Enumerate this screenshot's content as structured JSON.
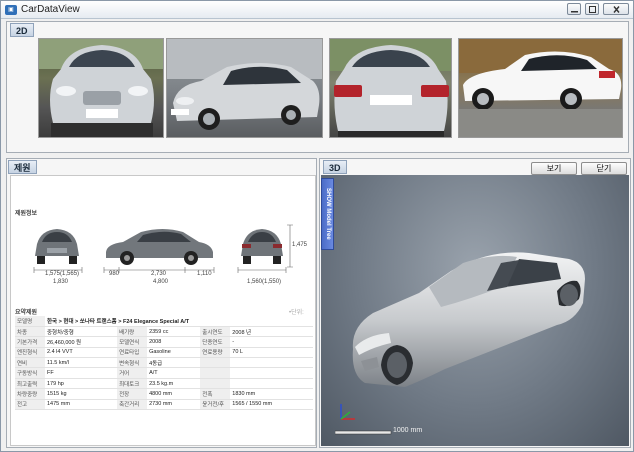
{
  "window": {
    "title": "CarDataView",
    "icon": "app-icon"
  },
  "tabs": {
    "photos": "2D",
    "specs": "제원",
    "viewer": "3D"
  },
  "viewer": {
    "side_tab": "SHOW Model Tree",
    "view_button": "보기",
    "close_button": "닫기",
    "scale_label": "1000 mm",
    "axis_labels": {
      "z": "Z",
      "x": "X",
      "y": "Y"
    }
  },
  "specs": {
    "section_title": "제원정보",
    "dims": {
      "front_track": "1,575(1,565)",
      "front_width": "1,830",
      "side_a": "980",
      "wheelbase": "2,730",
      "side_b": "1,110",
      "length": "4,800",
      "height": "1,475",
      "rear_track": "1,560(1,550)"
    },
    "summary_title": "요약제원",
    "summary_note": "•단위:",
    "rows": [
      [
        {
          "k": "모델명",
          "v": "한국 > 현대 > 쏘나타 트랜스폼 > F24 Elegance Special A/T",
          "span": true
        }
      ],
      [
        {
          "k": "차종",
          "v": "중형차/중형"
        },
        {
          "k": "배기량",
          "v": "2359 cc"
        },
        {
          "k": "출시연도",
          "v": "2008 년"
        }
      ],
      [
        {
          "k": "기본가격",
          "v": "26,460,000 원"
        },
        {
          "k": "모델연식",
          "v": "2008"
        },
        {
          "k": "단종연도",
          "v": "-"
        }
      ],
      [
        {
          "k": "엔진형식",
          "v": "2.4 l4 VVT"
        },
        {
          "k": "연료타입",
          "v": "Gasoline"
        },
        {
          "k": "연료용량",
          "v": "70 L"
        }
      ],
      [
        {
          "k": "연비",
          "v": "11.5 km/l"
        },
        {
          "k": "변속형식",
          "v": "4동급"
        },
        {
          "k": "",
          "v": ""
        }
      ],
      [
        {
          "k": "구동방식",
          "v": "FF"
        },
        {
          "k": "거어",
          "v": "A/T"
        },
        {
          "k": "",
          "v": ""
        }
      ],
      [
        {
          "k": "최고출력",
          "v": "179 hp"
        },
        {
          "k": "최대토크",
          "v": "23.5 kg.m"
        },
        {
          "k": "",
          "v": ""
        }
      ],
      [
        {
          "k": "차량중량",
          "v": "1515 kg"
        },
        {
          "k": "전장",
          "v": "4800 mm"
        },
        {
          "k": "전폭",
          "v": "1830 mm"
        }
      ],
      [
        {
          "k": "전고",
          "v": "1475 mm"
        },
        {
          "k": "축간거리",
          "v": "2730 mm"
        },
        {
          "k": "윤거전/후",
          "v": "1565 / 1550 mm"
        }
      ]
    ]
  },
  "colors": {
    "car_body": "#d8dadd",
    "viewer_bg": "#707a86",
    "tab_blue": "#4b6cc7"
  }
}
